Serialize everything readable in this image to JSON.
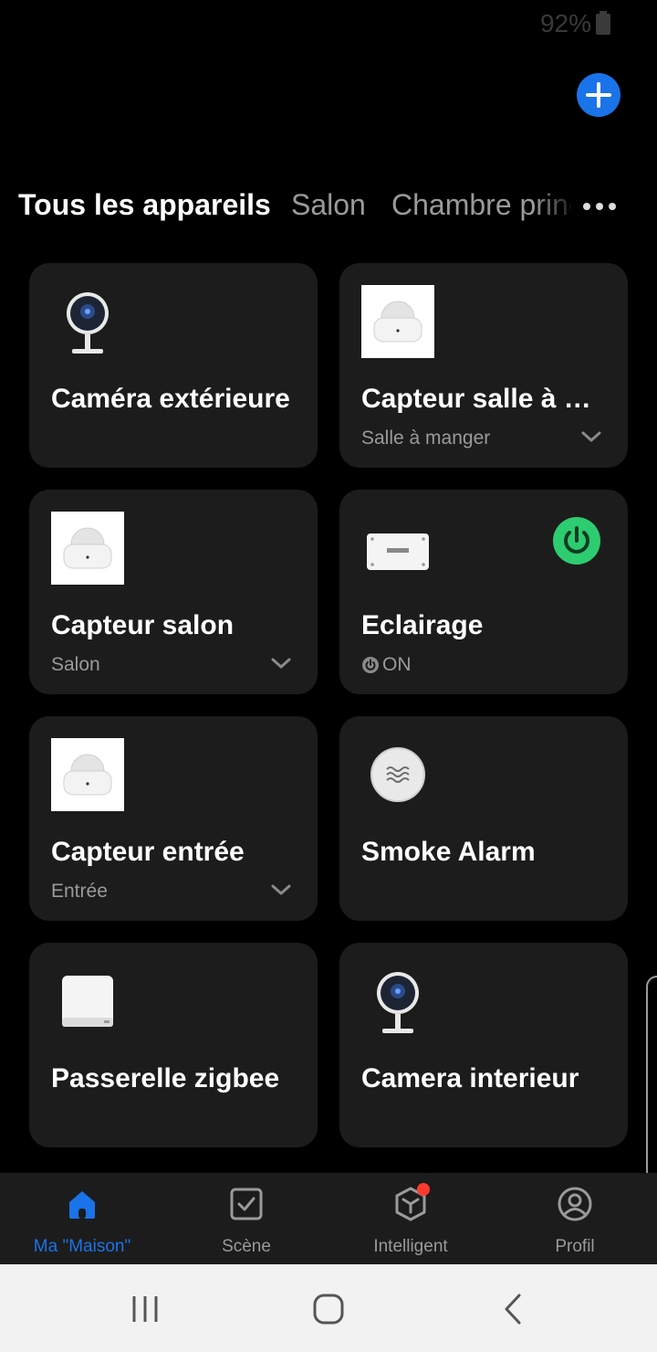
{
  "status_bar": {
    "battery": "92%"
  },
  "tabs": {
    "items": [
      {
        "label": "Tous les appareils"
      },
      {
        "label": "Salon"
      },
      {
        "label": "Chambre principale"
      }
    ]
  },
  "devices": [
    {
      "name": "Caméra extérieure",
      "room": "",
      "icon": "camera-icon"
    },
    {
      "name": "Capteur salle à manger",
      "room": "Salle à manger",
      "icon": "motion-sensor-icon"
    },
    {
      "name": "Capteur salon",
      "room": "Salon",
      "icon": "motion-sensor-icon"
    },
    {
      "name": "Eclairage",
      "state": "ON",
      "icon": "smart-switch-icon",
      "toggle_color": "#2ecc71"
    },
    {
      "name": "Capteur entrée",
      "room": "Entrée",
      "icon": "motion-sensor-icon"
    },
    {
      "name": "Smoke Alarm",
      "room": "",
      "icon": "smoke-alarm-icon"
    },
    {
      "name": "Passerelle zigbee",
      "room": "",
      "icon": "zigbee-gateway-icon"
    },
    {
      "name": "Camera interieur",
      "room": "",
      "icon": "camera-icon"
    }
  ],
  "bottom_nav": {
    "items": [
      {
        "label": "Ma \"Maison\"",
        "icon": "home-icon",
        "active": true
      },
      {
        "label": "Scène",
        "icon": "scene-checkbox-icon"
      },
      {
        "label": "Intelligent",
        "icon": "smart-cube-icon",
        "badge": true
      },
      {
        "label": "Profil",
        "icon": "profile-icon"
      }
    ]
  },
  "colors": {
    "accent": "#1a73e8",
    "card": "#1c1c1c",
    "power_on": "#2ecc71",
    "badge": "#ff3b30"
  }
}
